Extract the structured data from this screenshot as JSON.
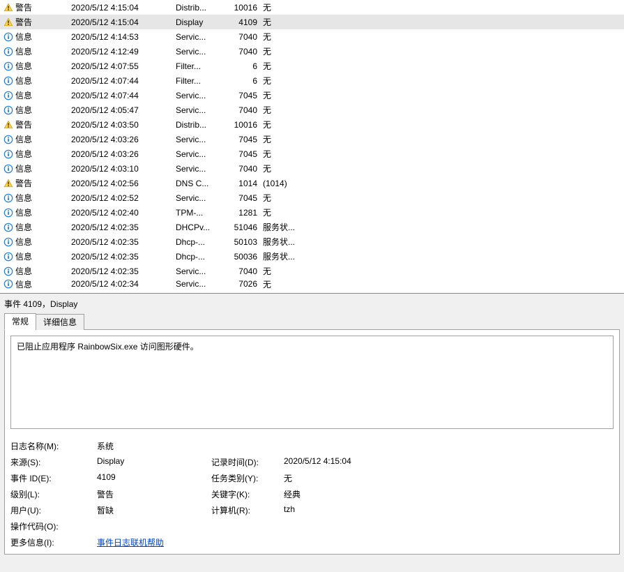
{
  "events": [
    {
      "level": "警告",
      "date": "2020/5/12 4:15:04",
      "source": "Distrib...",
      "id": "10016",
      "cat": "无",
      "iconKind": "warn"
    },
    {
      "level": "警告",
      "date": "2020/5/12 4:15:04",
      "source": "Display",
      "id": "4109",
      "cat": "无",
      "iconKind": "warn",
      "selected": true
    },
    {
      "level": "信息",
      "date": "2020/5/12 4:14:53",
      "source": "Servic...",
      "id": "7040",
      "cat": "无",
      "iconKind": "info"
    },
    {
      "level": "信息",
      "date": "2020/5/12 4:12:49",
      "source": "Servic...",
      "id": "7040",
      "cat": "无",
      "iconKind": "info"
    },
    {
      "level": "信息",
      "date": "2020/5/12 4:07:55",
      "source": "Filter...",
      "id": "6",
      "cat": "无",
      "iconKind": "info"
    },
    {
      "level": "信息",
      "date": "2020/5/12 4:07:44",
      "source": "Filter...",
      "id": "6",
      "cat": "无",
      "iconKind": "info"
    },
    {
      "level": "信息",
      "date": "2020/5/12 4:07:44",
      "source": "Servic...",
      "id": "7045",
      "cat": "无",
      "iconKind": "info"
    },
    {
      "level": "信息",
      "date": "2020/5/12 4:05:47",
      "source": "Servic...",
      "id": "7040",
      "cat": "无",
      "iconKind": "info"
    },
    {
      "level": "警告",
      "date": "2020/5/12 4:03:50",
      "source": "Distrib...",
      "id": "10016",
      "cat": "无",
      "iconKind": "warn"
    },
    {
      "level": "信息",
      "date": "2020/5/12 4:03:26",
      "source": "Servic...",
      "id": "7045",
      "cat": "无",
      "iconKind": "info"
    },
    {
      "level": "信息",
      "date": "2020/5/12 4:03:26",
      "source": "Servic...",
      "id": "7045",
      "cat": "无",
      "iconKind": "info"
    },
    {
      "level": "信息",
      "date": "2020/5/12 4:03:10",
      "source": "Servic...",
      "id": "7040",
      "cat": "无",
      "iconKind": "info"
    },
    {
      "level": "警告",
      "date": "2020/5/12 4:02:56",
      "source": "DNS C...",
      "id": "1014",
      "cat": "(1014)",
      "iconKind": "warn"
    },
    {
      "level": "信息",
      "date": "2020/5/12 4:02:52",
      "source": "Servic...",
      "id": "7045",
      "cat": "无",
      "iconKind": "info"
    },
    {
      "level": "信息",
      "date": "2020/5/12 4:02:40",
      "source": "TPM-...",
      "id": "1281",
      "cat": "无",
      "iconKind": "info"
    },
    {
      "level": "信息",
      "date": "2020/5/12 4:02:35",
      "source": "DHCPv...",
      "id": "51046",
      "cat": "服务状...",
      "iconKind": "info"
    },
    {
      "level": "信息",
      "date": "2020/5/12 4:02:35",
      "source": "Dhcp-...",
      "id": "50103",
      "cat": "服务状...",
      "iconKind": "info"
    },
    {
      "level": "信息",
      "date": "2020/5/12 4:02:35",
      "source": "Dhcp-...",
      "id": "50036",
      "cat": "服务状...",
      "iconKind": "info"
    },
    {
      "level": "信息",
      "date": "2020/5/12 4:02:35",
      "source": "Servic...",
      "id": "7040",
      "cat": "无",
      "iconKind": "info"
    },
    {
      "level": "信息",
      "date": "2020/5/12 4:02:34",
      "source": "Servic...",
      "id": "7026",
      "cat": "无",
      "iconKind": "info",
      "cut": true
    }
  ],
  "detail": {
    "title": "事件 4109，Display",
    "tabs": {
      "general": "常规",
      "details": "详细信息"
    },
    "message": "已阻止应用程序 RainbowSix.exe 访问图形硬件。",
    "labels": {
      "logName": "日志名称(M):",
      "source": "来源(S):",
      "logged": "记录时间(D):",
      "eventId": "事件 ID(E):",
      "taskCat": "任务类别(Y):",
      "level": "级别(L):",
      "keywords": "关键字(K):",
      "user": "用户(U):",
      "computer": "计算机(R):",
      "opcode": "操作代码(O):",
      "moreInfo": "更多信息(I):"
    },
    "values": {
      "logName": "系统",
      "source": "Display",
      "logged": "2020/5/12 4:15:04",
      "eventId": "4109",
      "taskCat": "无",
      "level": "警告",
      "keywords": "经典",
      "user": "暂缺",
      "computer": "tzh",
      "opcode": "",
      "moreInfo": "事件日志联机帮助"
    }
  }
}
